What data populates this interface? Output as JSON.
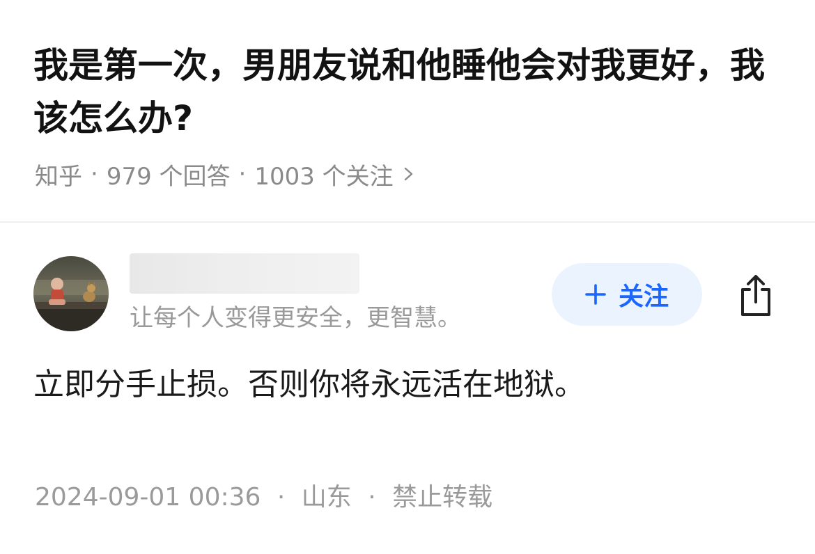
{
  "question": {
    "title": "我是第一次，男朋友说和他睡他会对我更好，我该怎么办?",
    "source": "知乎",
    "answers": "979 个回答",
    "followers": "1003 个关注",
    "separator": "·"
  },
  "author": {
    "headline": "让每个人变得更安全，更智慧。",
    "follow_label": "关注"
  },
  "answer": {
    "content": "立即分手止损。否则你将永远活在地狱。",
    "date": "2024-09-01 00:36",
    "location": "山东",
    "copyright": "禁止转载"
  },
  "colors": {
    "accent": "#1a66ff",
    "follow_bg": "#ebf3ff",
    "meta_text": "#8a8a8a"
  },
  "icons": {
    "follow": "plus-icon",
    "share": "share-icon",
    "meta_arrow": "chevron-right-icon"
  }
}
